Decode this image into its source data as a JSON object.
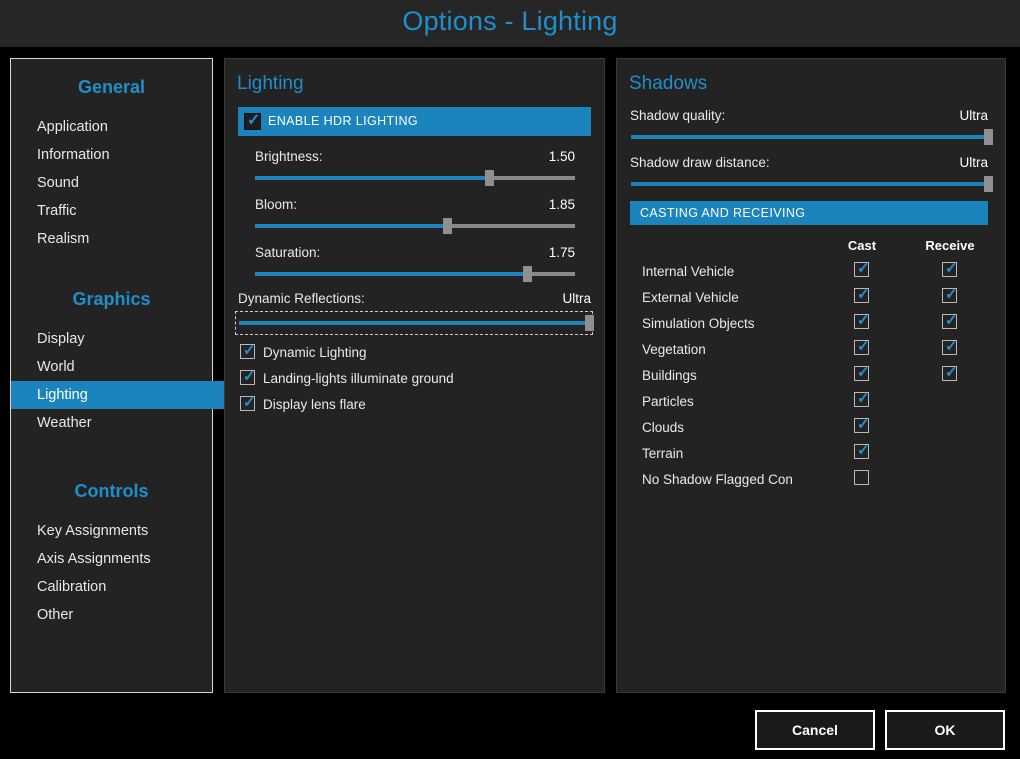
{
  "window": {
    "title": "Options - Lighting",
    "accent_color": "#1b84bd",
    "background_color": "#000000",
    "panel_color": "#232323"
  },
  "sidebar": {
    "groups": [
      {
        "title": "General",
        "items": [
          {
            "label": "Application",
            "selected": false
          },
          {
            "label": "Information",
            "selected": false
          },
          {
            "label": "Sound",
            "selected": false
          },
          {
            "label": "Traffic",
            "selected": false
          },
          {
            "label": "Realism",
            "selected": false
          }
        ]
      },
      {
        "title": "Graphics",
        "items": [
          {
            "label": "Display",
            "selected": false
          },
          {
            "label": "World",
            "selected": false
          },
          {
            "label": "Lighting",
            "selected": true
          },
          {
            "label": "Weather",
            "selected": false
          }
        ]
      },
      {
        "title": "Controls",
        "items": [
          {
            "label": "Key Assignments",
            "selected": false
          },
          {
            "label": "Axis Assignments",
            "selected": false
          },
          {
            "label": "Calibration",
            "selected": false
          },
          {
            "label": "Other",
            "selected": false
          }
        ]
      }
    ]
  },
  "lighting": {
    "heading": "Lighting",
    "hdr_banner": {
      "label": "ENABLE HDR LIGHTING",
      "checked": true
    },
    "sliders": [
      {
        "label": "Brightness:",
        "value": "1.50",
        "percent": 73
      },
      {
        "label": "Bloom:",
        "value": "1.85",
        "percent": 60
      },
      {
        "label": "Saturation:",
        "value": "1.75",
        "percent": 85
      }
    ],
    "reflections": {
      "label": "Dynamic Reflections:",
      "value": "Ultra",
      "percent": 100,
      "focused": true
    },
    "checkboxes": [
      {
        "label": "Dynamic Lighting",
        "checked": true
      },
      {
        "label": "Landing-lights illuminate ground",
        "checked": true
      },
      {
        "label": "Display lens flare",
        "checked": true
      }
    ]
  },
  "shadows": {
    "heading": "Shadows",
    "sliders": [
      {
        "label": "Shadow quality:",
        "value": "Ultra",
        "percent": 100
      },
      {
        "label": "Shadow draw distance:",
        "value": "Ultra",
        "percent": 100
      }
    ],
    "banner": "CASTING AND RECEIVING",
    "columns": [
      "Cast",
      "Receive"
    ],
    "rows": [
      {
        "label": "Internal Vehicle",
        "cast": true,
        "receive": true
      },
      {
        "label": "External Vehicle",
        "cast": true,
        "receive": true
      },
      {
        "label": "Simulation Objects",
        "cast": true,
        "receive": true
      },
      {
        "label": "Vegetation",
        "cast": true,
        "receive": true
      },
      {
        "label": "Buildings",
        "cast": true,
        "receive": true
      },
      {
        "label": "Particles",
        "cast": true,
        "receive": null
      },
      {
        "label": "Clouds",
        "cast": true,
        "receive": null
      },
      {
        "label": "Terrain",
        "cast": true,
        "receive": null
      },
      {
        "label": "No Shadow Flagged Content",
        "cast": false,
        "receive": null
      }
    ]
  },
  "footer": {
    "cancel_label": "Cancel",
    "ok_label": "OK"
  }
}
